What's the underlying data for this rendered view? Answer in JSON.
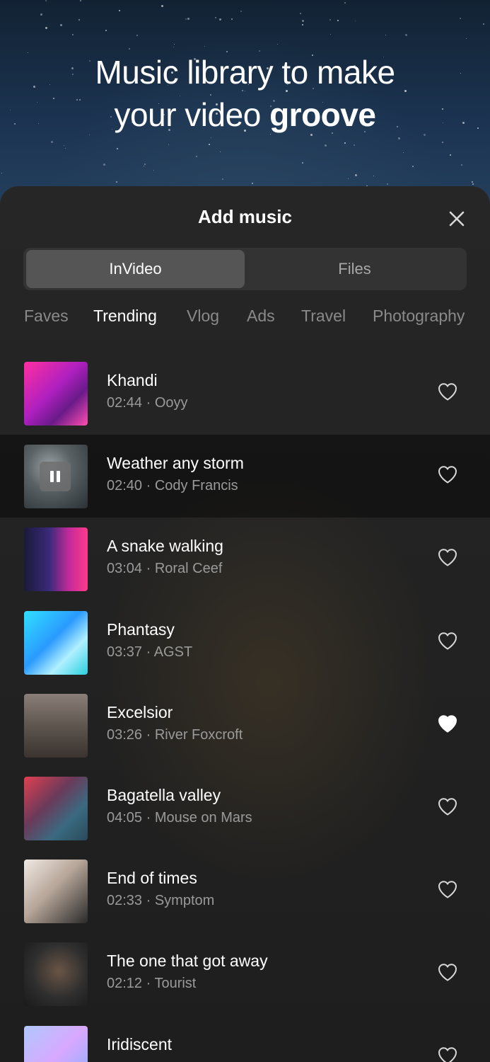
{
  "hero": {
    "headline_line1": "Music library to make",
    "headline_line2_plain": "your video ",
    "headline_line2_bold": "groove"
  },
  "sheet": {
    "title": "Add music",
    "close_icon": "close-icon"
  },
  "source_tabs": [
    {
      "label": "InVideo",
      "active": true
    },
    {
      "label": "Files",
      "active": false
    }
  ],
  "categories": [
    {
      "label": "Faves",
      "active": false
    },
    {
      "label": "Trending",
      "active": true
    },
    {
      "label": "Vlog",
      "active": false
    },
    {
      "label": "Ads",
      "active": false
    },
    {
      "label": "Travel",
      "active": false
    },
    {
      "label": "Photography",
      "active": false
    }
  ],
  "tracks": [
    {
      "title": "Khandi",
      "meta": "02:44 · Ooyy",
      "favorite": false,
      "playing": false
    },
    {
      "title": "Weather any storm",
      "meta": "02:40 · Cody Francis",
      "favorite": false,
      "playing": true
    },
    {
      "title": "A snake walking",
      "meta": "03:04 · Roral Ceef",
      "favorite": false,
      "playing": false
    },
    {
      "title": "Phantasy",
      "meta": "03:37 · AGST",
      "favorite": false,
      "playing": false
    },
    {
      "title": "Excelsior",
      "meta": "03:26 · River Foxcroft",
      "favorite": true,
      "playing": false
    },
    {
      "title": "Bagatella valley",
      "meta": "04:05 · Mouse on Mars",
      "favorite": false,
      "playing": false
    },
    {
      "title": "End of times",
      "meta": "02:33 · Symptom",
      "favorite": false,
      "playing": false
    },
    {
      "title": "The one that got away",
      "meta": "02:12 · Tourist",
      "favorite": false,
      "playing": false
    },
    {
      "title": "Iridiscent",
      "meta": "",
      "favorite": false,
      "playing": false
    }
  ],
  "colors": {
    "sheet_bg": "#232323",
    "active_text": "#ffffff",
    "inactive_text": "#8a8a8a",
    "meta_text": "#9a9a9a"
  }
}
